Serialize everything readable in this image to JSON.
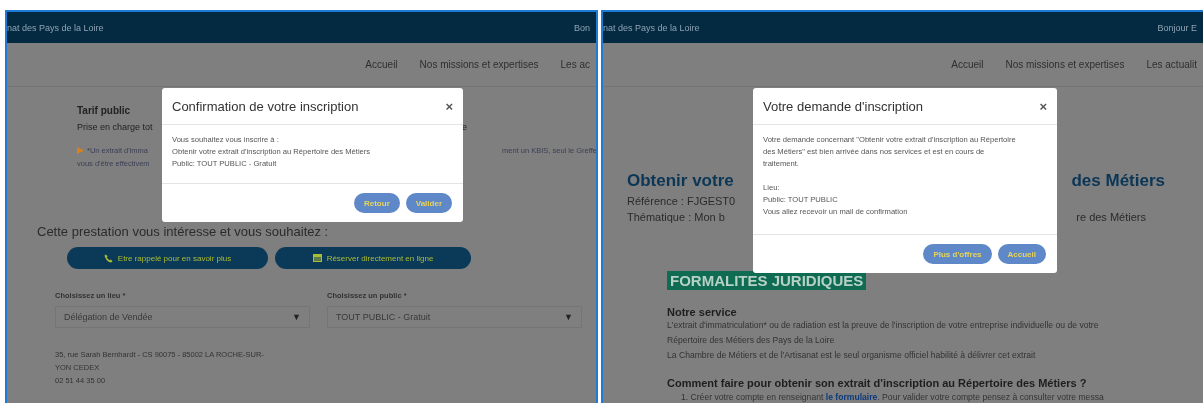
{
  "booking_page": {
    "header": {
      "site_name": "nat des Pays de la Loire",
      "greeting": "Bon"
    },
    "nav": [
      {
        "label": "Accueil"
      },
      {
        "label": "Nos missions et expertises"
      },
      {
        "label": "Les ac"
      }
    ],
    "tariff": {
      "title": "Tarif public",
      "line_left": "Prise en charge tot",
      "line_right": "e",
      "note_left": "*Un extrait d'imma",
      "note_right": "ment un KBIS, seul le Greffe",
      "note_line2": "vous d'être effectivem"
    },
    "prompt": "Cette prestation vous intéresse et vous souhaitez :",
    "actions": [
      {
        "label": "Etre rappelé pour en savoir plus",
        "kind": "phone"
      },
      {
        "label": "Réserver directement en ligne",
        "kind": "calendar"
      }
    ],
    "selects": [
      {
        "label": "Choisissez un lieu *",
        "value": "Délégation de Vendée",
        "arrow": "▼"
      },
      {
        "label": "Choisissez un public *",
        "value": "TOUT PUBLIC - Gratuit",
        "arrow": "▼"
      }
    ],
    "address": [
      "35, rue Sarah Bernhardt - CS 90075 - 85002 LA ROCHE-SUR-",
      "YON CEDEX",
      "02 51 44 35 00"
    ],
    "dialog": {
      "title": "Confirmation de votre inscription",
      "close": "×",
      "body": [
        [
          "Vous souhaitez vous inscrire à :",
          "Obtenir votre extrait d'inscription au Répertoire des Métiers",
          "Public: TOUT PUBLIC - Gratuit"
        ]
      ],
      "buttons": [
        "Retour",
        "Valider"
      ]
    }
  },
  "confirmation_page": {
    "header": {
      "site_name": "nat des Pays de la Loire",
      "greeting": "Bonjour E"
    },
    "nav": [
      {
        "label": "Accueil"
      },
      {
        "label": "Nos missions et expertises"
      },
      {
        "label": "Les actualit"
      }
    ],
    "title_left": "Obtenir votre",
    "title_right": "des Métiers",
    "reference": "Référence : FJGEST0",
    "theme_left": "Thématique : Mon b",
    "theme_right": "re des Métiers",
    "section_badge": "FORMALITES JURIDIQUES",
    "service_heading": "Notre service",
    "service_lines": [
      "L'extrait d'immatriculation* ou de radiation est la preuve de l'inscription de votre entreprise individuelle ou de votre",
      "Répertoire des Métiers des Pays de la Loire",
      "La Chambre de Métiers et de l'Artisanat est le seul organisme officiel habilité à délivrer cet extrait"
    ],
    "question_heading": "Comment faire pour obtenir son extrait d'inscription au Répertoire des Métiers ?",
    "step": {
      "before": "1. Créer votre compte en renseignant ",
      "link": "le formulaire",
      "after": ". Pour valider votre compte pensez à consulter votre messa"
    },
    "dialog": {
      "title": "Votre demande d'inscription",
      "close": "×",
      "body": [
        [
          "Votre demande concernant \"Obtenir votre extrait d'inscription au Répertoire des Métiers\" est bien arrivée dans nos services et est en cours de traitement."
        ],
        [
          "Lieu:",
          "Public: TOUT PUBLIC",
          "Vous allez recevoir un mail de confirmation"
        ]
      ],
      "buttons": [
        "Plus d'offres",
        "Accueil"
      ]
    }
  }
}
